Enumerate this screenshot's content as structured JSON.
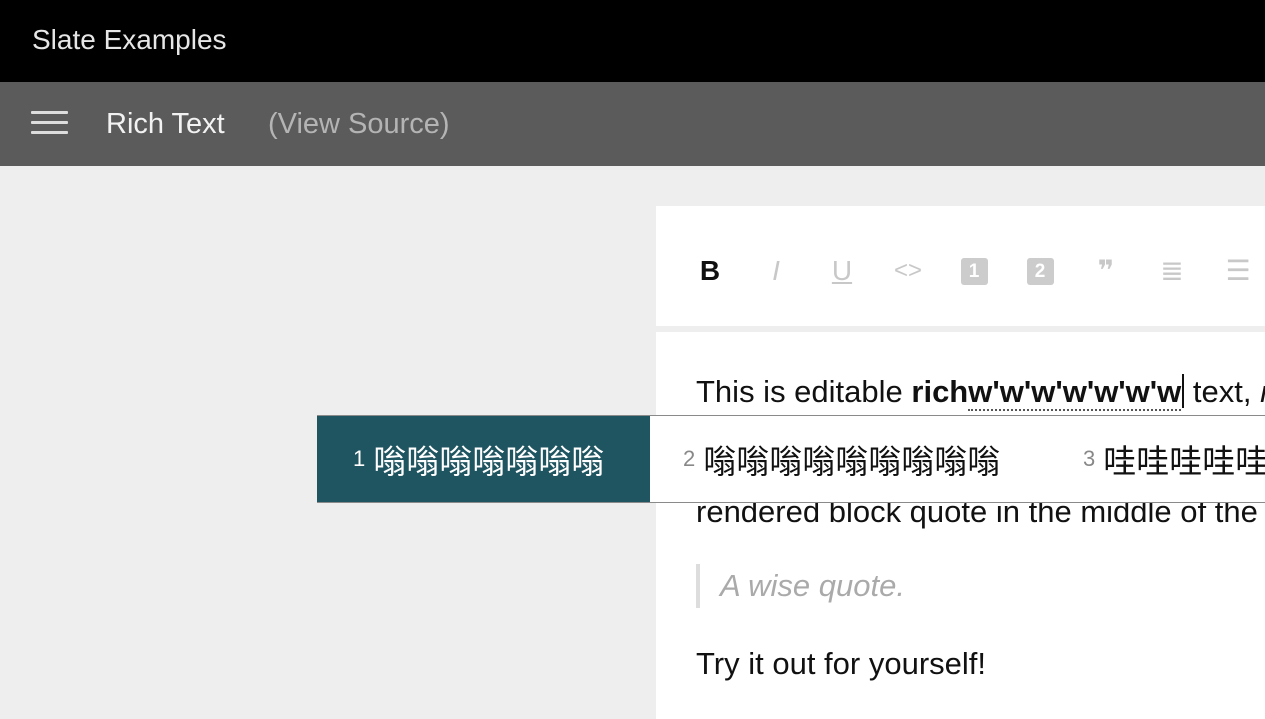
{
  "app": {
    "title": "Slate Examples"
  },
  "header": {
    "title": "Rich Text",
    "view_source": "(View Source)"
  },
  "toolbar": {
    "buttons": [
      {
        "icon": "bold-icon",
        "glyph": "B",
        "active": true
      },
      {
        "icon": "italic-icon",
        "glyph": "I",
        "active": false
      },
      {
        "icon": "underline-icon",
        "glyph": "U",
        "active": false
      },
      {
        "icon": "code-icon",
        "glyph": "<>",
        "active": false
      },
      {
        "icon": "heading-one-icon",
        "glyph": "1",
        "active": false
      },
      {
        "icon": "heading-two-icon",
        "glyph": "2",
        "active": false
      },
      {
        "icon": "block-quote-icon",
        "glyph": "❞",
        "active": false
      },
      {
        "icon": "numbered-list-icon",
        "glyph": "≣",
        "active": false
      },
      {
        "icon": "bulleted-list-icon",
        "glyph": "☰",
        "active": false
      }
    ]
  },
  "editor": {
    "line1_prefix": "This is editable ",
    "line1_bold": "rich",
    "line1_composing": "w'w'w'w'w'w'w",
    "line1_suffix": " text, ",
    "line1_italic": "m",
    "line2": "rendered block quote in the middle of the",
    "quote": "A wise quote.",
    "line4": "Try it out for yourself!"
  },
  "ime": {
    "candidates": [
      {
        "number": "1",
        "text": "嗡嗡嗡嗡嗡嗡嗡",
        "selected": true
      },
      {
        "number": "2",
        "text": "嗡嗡嗡嗡嗡嗡嗡嗡嗡",
        "selected": false
      },
      {
        "number": "3",
        "text": "哇哇哇哇哇",
        "selected": false
      }
    ]
  },
  "colors": {
    "top_bar": "#000000",
    "sub_bar": "#5b5b5b",
    "page_background": "#eeeeee",
    "ime_selected": "#1f5561"
  }
}
